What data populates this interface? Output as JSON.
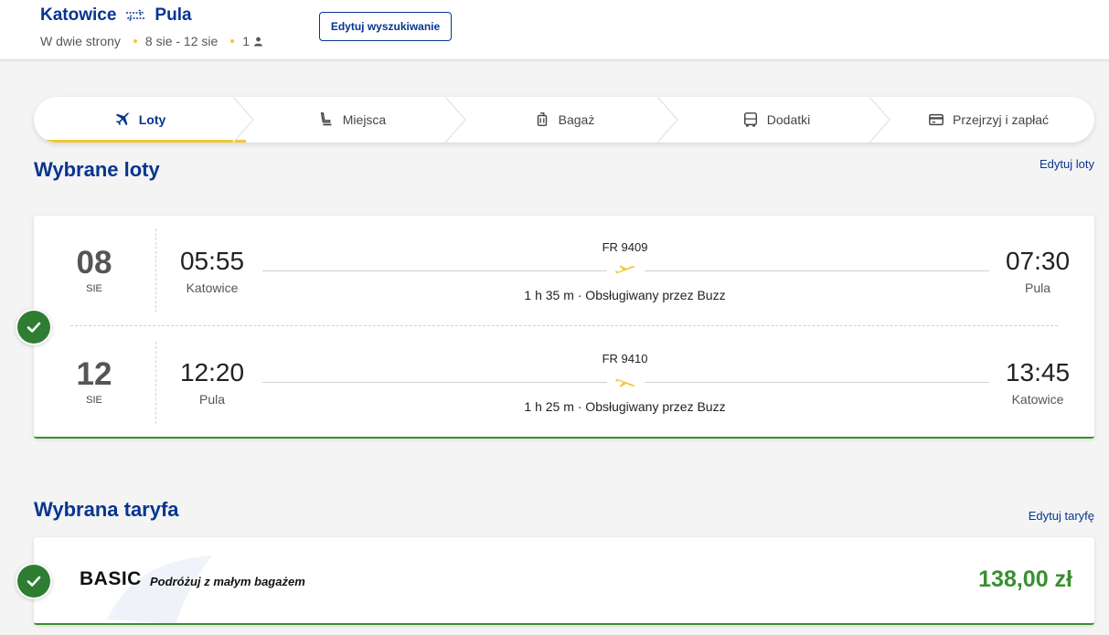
{
  "header": {
    "origin": "Katowice",
    "destination": "Pula",
    "trip_type": "W dwie strony",
    "dates": "8 sie - 12 sie",
    "passengers": "1",
    "edit_search_label": "Edytuj wyszukiwanie"
  },
  "steps": [
    {
      "label": "Loty",
      "icon": "plane-icon",
      "active": true
    },
    {
      "label": "Miejsca",
      "icon": "seat-icon",
      "active": false
    },
    {
      "label": "Bagaż",
      "icon": "luggage-icon",
      "active": false
    },
    {
      "label": "Dodatki",
      "icon": "bus-icon",
      "active": false
    },
    {
      "label": "Przejrzyj i zapłać",
      "icon": "card-icon",
      "active": false
    }
  ],
  "flights_section": {
    "title": "Wybrane loty",
    "edit_label": "Edytuj loty",
    "legs": [
      {
        "day": "08",
        "month": "SIE",
        "dep_time": "05:55",
        "dep_city": "Katowice",
        "arr_time": "07:30",
        "arr_city": "Pula",
        "flight_no": "FR 9409",
        "details": "1 h 35 m · Obsługiwany przez Buzz",
        "direction": "takeoff"
      },
      {
        "day": "12",
        "month": "SIE",
        "dep_time": "12:20",
        "dep_city": "Pula",
        "arr_time": "13:45",
        "arr_city": "Katowice",
        "flight_no": "FR 9410",
        "details": "1 h 25 m · Obsługiwany przez Buzz",
        "direction": "landing"
      }
    ]
  },
  "fare_section": {
    "title": "Wybrana taryfa",
    "edit_label": "Edytuj taryfę",
    "fare_name": "BASIC",
    "fare_desc": "Podróżuj z małym bagażem",
    "price": "138,00 zł"
  },
  "colors": {
    "brand_blue": "#073590",
    "accent_yellow": "#f1c933",
    "success_green": "#3a8f2f"
  }
}
